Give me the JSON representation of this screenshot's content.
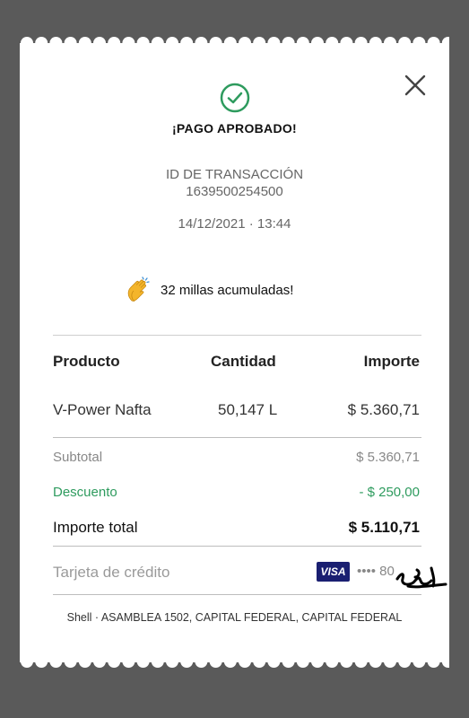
{
  "status": {
    "title": "¡PAGO APROBADO!"
  },
  "transaction": {
    "id_label": "ID DE TRANSACCIÓN",
    "id": "1639500254500",
    "datetime": "14/12/2021 · 13:44"
  },
  "rewards": {
    "text": "32 millas acumuladas!",
    "icon": "clapping-hands-icon"
  },
  "table": {
    "headers": [
      "Producto",
      "Cantidad",
      "Importe"
    ],
    "rows": [
      {
        "product": "V-Power Nafta",
        "quantity": "50,147 L",
        "amount": "$ 5.360,71"
      }
    ]
  },
  "summary": {
    "subtotal_label": "Subtotal",
    "subtotal_value": "$ 5.360,71",
    "discount_label": "Descuento",
    "discount_value": "- $ 250,00",
    "total_label": "Importe total",
    "total_value": "$ 5.110,71"
  },
  "payment": {
    "method_label": "Tarjeta de crédito",
    "card_brand": "VISA",
    "card_mask": "•••• 80"
  },
  "footer": {
    "location": "Shell · ASAMBLEA 1502, CAPITAL FEDERAL, CAPITAL FEDERAL"
  },
  "colors": {
    "success": "#2e9b5e",
    "visa": "#1a1f71",
    "background": "#5a5a5a"
  }
}
